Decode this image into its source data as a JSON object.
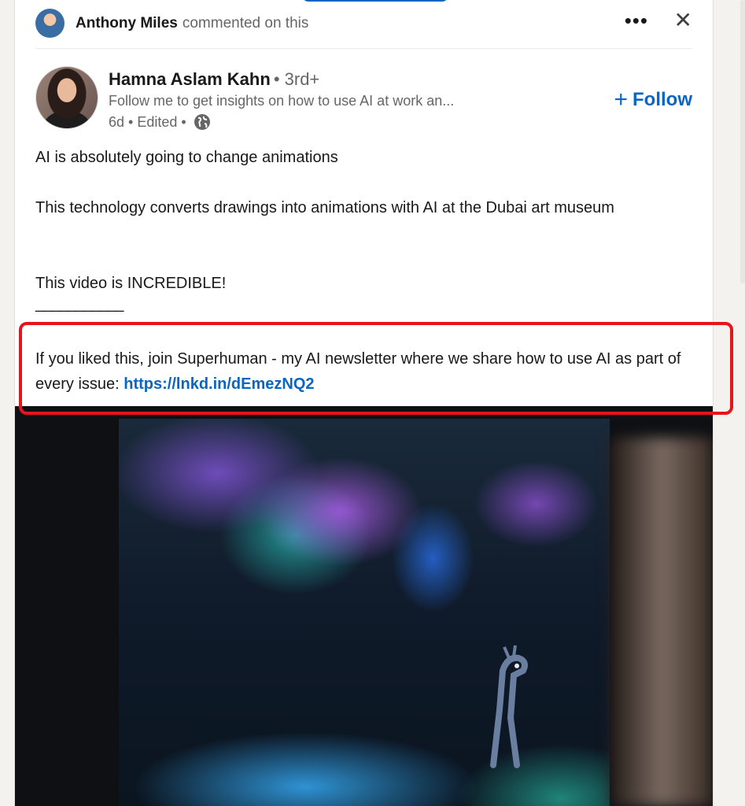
{
  "activity": {
    "actor": "Anthony Miles",
    "action": "commented on this",
    "more_icon": "more-horizontal-icon",
    "close_icon": "close-icon"
  },
  "post": {
    "author": {
      "name": "Hamna Aslam Kahn",
      "degree": "• 3rd+",
      "headline": "Follow me to get insights on how to use AI at work an...",
      "time": "6d • Edited •",
      "visibility_icon": "globe-icon"
    },
    "follow_label": "Follow",
    "paragraphs": [
      "AI is absolutely going to change animations",
      "This technology converts drawings into animations with AI at the Dubai art museum",
      "This video is INCREDIBLE!",
      "___________"
    ],
    "cta_text": "If you liked this, join Superhuman - my AI newsletter where we share how to use AI as part of every issue: ",
    "cta_link": "https://lnkd.in/dEmezNQ2"
  },
  "colors": {
    "link_blue": "#0a66c2",
    "highlight_red": "#e8141b",
    "text": "#191919",
    "muted": "#666666"
  }
}
